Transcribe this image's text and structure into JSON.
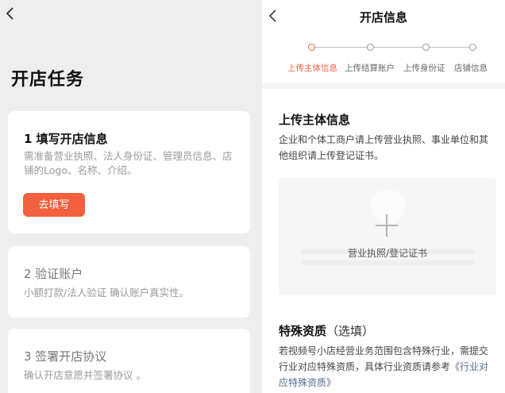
{
  "left": {
    "title": "开店任务",
    "cards": [
      {
        "title": "1 填写开店信息",
        "desc": "需准备营业执照、法人身份证、管理员信息、店铺的Logo、名称、介绍。",
        "button": "去填写"
      },
      {
        "title": "2 验证账户",
        "desc": "小额打款/法人验证 确认账户真实性。"
      },
      {
        "title": "3 签署开店协议",
        "desc": "确认开店意愿并签署协议 。"
      }
    ]
  },
  "right": {
    "title": "开店信息",
    "steps": [
      {
        "label": "上传主体信息",
        "active": true
      },
      {
        "label": "上传结算账户",
        "active": false
      },
      {
        "label": "上传身份证",
        "active": false
      },
      {
        "label": "店铺信息",
        "active": false
      }
    ],
    "section1": {
      "title": "上传主体信息",
      "desc": "企业和个体工商户请上传营业执照、事业单位和其他组织请上传登记证书。",
      "upload_label": "营业执照/登记证书"
    },
    "section2": {
      "title": "特殊资质",
      "optional": "（选填）",
      "desc_prefix": "若视频号小店经营业务范围包含特殊行业，需提交行业对应特殊资质，具体行业资质请参考",
      "link": "《行业对应特殊资质》"
    }
  },
  "colors": {
    "accent": "#f2603d",
    "link": "#576b95"
  }
}
